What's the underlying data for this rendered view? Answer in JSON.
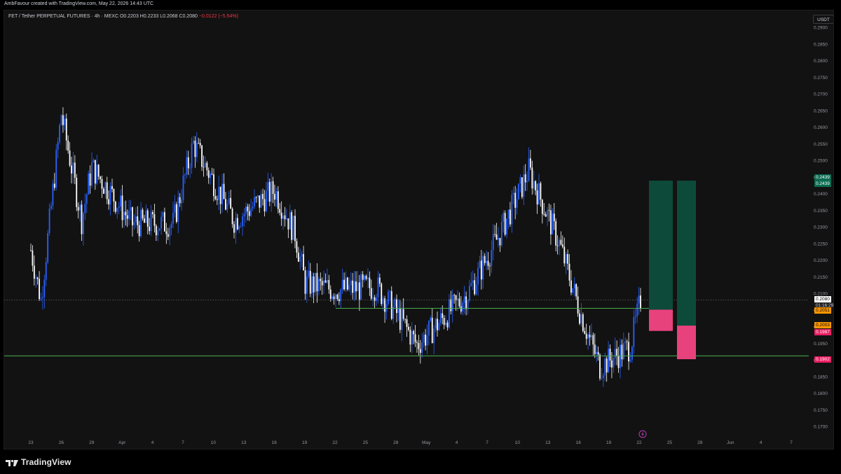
{
  "header": {
    "attribution": "AmbFavour created with TradingView.com, May 22, 2026 14:43 UTC"
  },
  "symbol_bar": {
    "name": "FET / Tether PERPETUAL FUTURES · 4h · MEXC",
    "open": "O0.2203",
    "high": "H0.2233",
    "low": "L0.2068",
    "close": "C0.2080",
    "change": "−0.0122 (−5.54%)"
  },
  "currency": "USDT",
  "price_axis": {
    "ticks": [
      "0.2900",
      "0.2850",
      "0.2800",
      "0.2750",
      "0.2700",
      "0.2650",
      "0.2600",
      "0.2550",
      "0.2500",
      "0.2450",
      "0.2400",
      "0.2350",
      "0.2300",
      "0.2250",
      "0.2200",
      "0.2150",
      "0.2100",
      "0.2050",
      "0.2000",
      "0.1950",
      "0.1900",
      "0.1850",
      "0.1800",
      "0.1750",
      "0.1700"
    ]
  },
  "price_tags": {
    "tp_a": "0.2439",
    "tp_b": "0.2439",
    "last_price": "0.2080",
    "countdown": "01:16:29",
    "entry_a": "0.2051",
    "entry_b": "0.2003",
    "stop_a": "0.1987",
    "stop_b": "0.1902"
  },
  "time_axis": {
    "labels": [
      "23",
      "26",
      "29",
      "Apr",
      "4",
      "7",
      "10",
      "13",
      "16",
      "19",
      "22",
      "25",
      "28",
      "May",
      "4",
      "7",
      "10",
      "13",
      "16",
      "19",
      "22",
      "25",
      "28",
      "Jun",
      "4",
      "7"
    ]
  },
  "footer": {
    "brand": "TradingView"
  },
  "colors": {
    "bull": "#2962ff",
    "bear": "#ffffff",
    "profit_zone": "#0d4a3a",
    "loss_zone": "#e8427c",
    "support_line": "#4caf50",
    "entry_tag": "#ff9800",
    "stop_tag": "#e91e63",
    "tp_tag": "#0b6b50"
  },
  "chart_data": {
    "type": "candlestick",
    "interval": "4h",
    "ylim": [
      0.168,
      0.292
    ],
    "horizontal_levels": [
      0.2055,
      0.1912
    ],
    "key_path": [
      {
        "date": "Mar 23",
        "price": 0.223
      },
      {
        "date": "Mar 24",
        "price": 0.208
      },
      {
        "date": "Mar 26",
        "price": 0.264
      },
      {
        "date": "Mar 28",
        "price": 0.232
      },
      {
        "date": "Mar 29",
        "price": 0.248
      },
      {
        "date": "Apr 2",
        "price": 0.231
      },
      {
        "date": "Apr 6",
        "price": 0.231
      },
      {
        "date": "Apr 8",
        "price": 0.255
      },
      {
        "date": "Apr 12",
        "price": 0.232
      },
      {
        "date": "Apr 16",
        "price": 0.241
      },
      {
        "date": "Apr 18",
        "price": 0.228
      },
      {
        "date": "Apr 19",
        "price": 0.213
      },
      {
        "date": "Apr 22",
        "price": 0.211
      },
      {
        "date": "Apr 26",
        "price": 0.212
      },
      {
        "date": "Apr 28",
        "price": 0.204
      },
      {
        "date": "Apr 30",
        "price": 0.1945
      },
      {
        "date": "May 5",
        "price": 0.21
      },
      {
        "date": "May 8",
        "price": 0.227
      },
      {
        "date": "May 10",
        "price": 0.24
      },
      {
        "date": "May 11",
        "price": 0.247
      },
      {
        "date": "May 14",
        "price": 0.225
      },
      {
        "date": "May 16",
        "price": 0.205
      },
      {
        "date": "May 17",
        "price": 0.196
      },
      {
        "date": "May 18",
        "price": 0.188
      },
      {
        "date": "May 21",
        "price": 0.194
      },
      {
        "date": "May 22",
        "price": 0.208
      }
    ],
    "positions": [
      {
        "type": "long",
        "entry": 0.2051,
        "stop": 0.1987,
        "target": 0.2439
      },
      {
        "type": "long",
        "entry": 0.2003,
        "stop": 0.1902,
        "target": 0.2439
      }
    ]
  }
}
